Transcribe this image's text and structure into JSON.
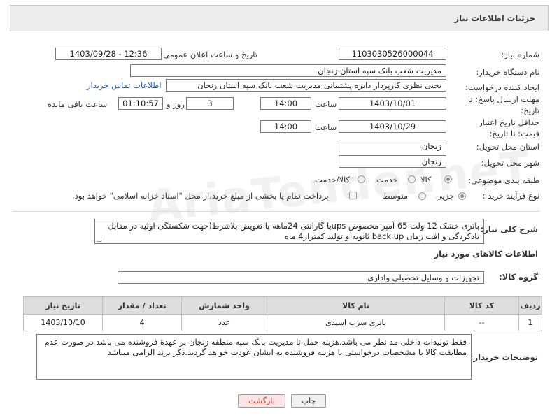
{
  "header": {
    "title": "جزئیات اطلاعات نیاز"
  },
  "fields": {
    "need_number": {
      "label": "شماره نیاز:",
      "value": "1103030526000044"
    },
    "announce_datetime": {
      "label": "تاریخ و ساعت اعلان عمومی:",
      "value": "1403/09/28 - 12:36"
    },
    "buyer_org": {
      "label": "نام دستگاه خریدار:",
      "value": "مدیریت شعب بانک سپه استان زنجان"
    },
    "requester": {
      "label": "ایجاد کننده درخواست:",
      "value": "یحیی نظری کارپرداز دایره پشتیبانی  مدیریت شعب بانک سپه استان زنجان",
      "link": "اطلاعات تماس خریدار"
    },
    "reply_deadline": {
      "label": "مهلت ارسال پاسخ: تا تاریخ:",
      "date": "1403/10/01",
      "time_label": "ساعت",
      "time": "14:00",
      "days": "3",
      "days_label": "روز و",
      "remaining": "01:10:57",
      "remaining_label": "ساعت باقی مانده"
    },
    "price_validity": {
      "label": "حداقل تاریخ اعتبار قیمت: تا تاریخ:",
      "date": "1403/10/29",
      "time_label": "ساعت",
      "time": "14:00"
    },
    "province": {
      "label": "استان محل تحویل:",
      "value": "زنجان"
    },
    "city": {
      "label": "شهر محل تحویل:",
      "value": "زنجان"
    },
    "category": {
      "label": "طبقه بندی موضوعی:",
      "options": [
        "کالا",
        "خدمت",
        "کالا/خدمت"
      ],
      "selected": "کالا"
    },
    "purchase_type": {
      "label": "نوع فرآیند خرید :",
      "options": [
        "جزیی",
        "متوسط"
      ],
      "selected": "جزیی",
      "payment_note": "پرداخت تمام یا بخشی از مبلغ خرید،از محل \"اسناد خزانه اسلامی\" خواهد بود."
    }
  },
  "description": {
    "label": "شرح کلی نیاز:",
    "value": "باتری خشک 12 ولت 65 آمپر مخصوص upsبا گارانتی 24ماهه با تعویض بلاشرط(جهت شکستگی اولیه در مقابل بادکردگی و افت زمان back up ثانویه و تولید کمتراز4 ماه"
  },
  "goods_info": {
    "title": "اطلاعات کالاهای مورد نیاز",
    "group_label": "گروه کالا:",
    "group_value": "تجهیزات و وسایل تحصیلی واداری"
  },
  "table": {
    "headers": [
      "ردیف",
      "کد کالا",
      "نام کالا",
      "واحد شمارش",
      "تعداد / مقدار",
      "تاریخ نیاز"
    ],
    "rows": [
      [
        "1",
        "--",
        "باتری سرب اسیدی",
        "عدد",
        "4",
        "1403/10/10"
      ]
    ]
  },
  "buyer_notes": {
    "label": "توضیحات خریدار:",
    "value": "فقط تولیدات داخلی مد نظر می باشد.هزینه حمل تا مدیریت بانک سپه منطقه زنجان بر عهدهٔ فروشنده می باشد در صورت عدم مطابقت کالا با مشخصات درخواستی با هزینه فروشنده به ایشان عودت خواهد گردید.ذکر برند الزامی میباشد"
  },
  "buttons": {
    "print": "چاپ",
    "back": "بازگشت"
  },
  "colors": {
    "header_bg": "#ececec",
    "back_button_bg": "#fde3e3",
    "back_button_text": "#c0392b",
    "link": "#1a5bbf"
  }
}
